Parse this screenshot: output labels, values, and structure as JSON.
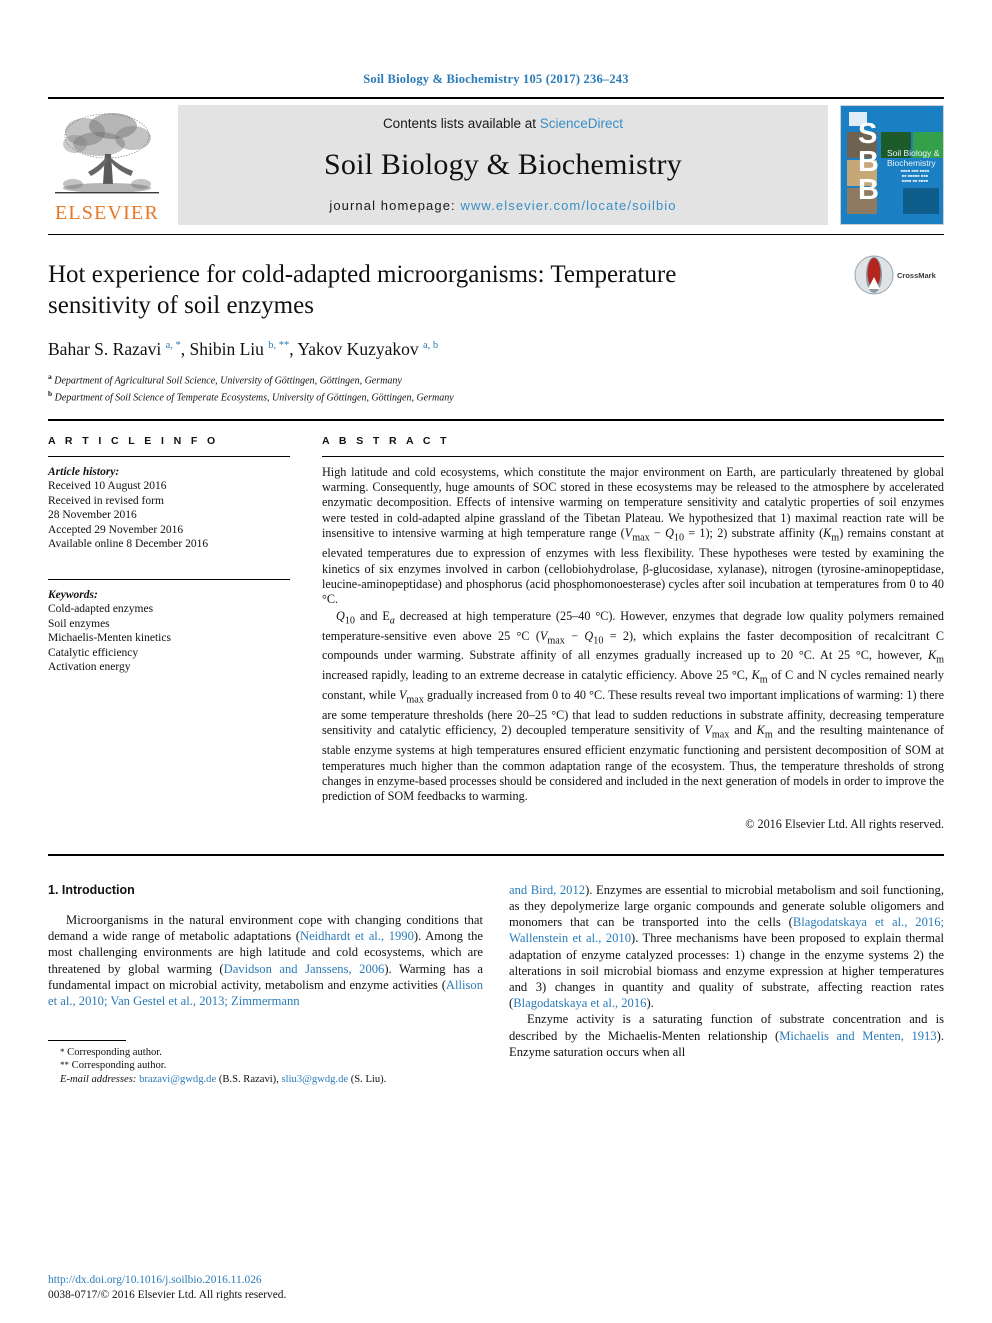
{
  "colors": {
    "link_blue": "#2b7bb9",
    "sciencedirect_blue": "#3a8ec4",
    "elsevier_orange": "#e87722",
    "cover_blue": "#1b7fc4",
    "masthead_grey": "#e3e3e3"
  },
  "running_head": "Soil Biology & Biochemistry 105 (2017) 236–243",
  "masthead": {
    "publisher": "ELSEVIER",
    "contents_prefix": "Contents lists available at ",
    "contents_link": "ScienceDirect",
    "journal_name": "Soil Biology & Biochemistry",
    "homepage_prefix": "journal homepage: ",
    "homepage_url": "www.elsevier.com/locate/soilbio",
    "cover": {
      "letters": "S\nB\nB",
      "title_line1": "Soil Biology &",
      "title_line2": "Biochemistry"
    }
  },
  "article": {
    "title": "Hot experience for cold-adapted microorganisms: Temperature sensitivity of soil enzymes",
    "crossmark_label": "CrossMark",
    "authors_html": "Bahar S. Razavi <sup>a, *</sup>, Shibin Liu <sup>b, **</sup>, Yakov Kuzyakov <sup>a, b</sup>",
    "affiliations": [
      {
        "mark": "a",
        "text": "Department of Agricultural Soil Science, University of Göttingen, Göttingen, Germany"
      },
      {
        "mark": "b",
        "text": "Department of Soil Science of Temperate Ecosystems, University of Göttingen, Göttingen, Germany"
      }
    ]
  },
  "article_info": {
    "heading": "A R T I C L E   I N F O",
    "history_label": "Article history:",
    "history": [
      "Received 10 August 2016",
      "Received in revised form",
      "28 November 2016",
      "Accepted 29 November 2016",
      "Available online 8 December 2016"
    ],
    "keywords_label": "Keywords:",
    "keywords": [
      "Cold-adapted enzymes",
      "Soil enzymes",
      "Michaelis-Menten kinetics",
      "Catalytic efficiency",
      "Activation energy"
    ]
  },
  "abstract": {
    "heading": "A B S T R A C T",
    "paragraph1_html": "High latitude and cold ecosystems, which constitute the major environment on Earth, are particularly threatened by global warming. Consequently, huge amounts of SOC stored in these ecosystems may be released to the atmosphere by accelerated enzymatic decomposition. Effects of intensive warming on temperature sensitivity and catalytic properties of soil enzymes were tested in cold-adapted alpine grassland of the Tibetan Plateau. We hypothesized that 1) maximal reaction rate will be insensitive to intensive warming at high temperature range (<i>V</i><sub>max</sub> &minus; <i>Q</i><sub>10</sub> = 1); 2) substrate affinity (<i>K</i><sub>m</sub>) remains constant at elevated temperatures due to expression of enzymes with less flexibility. These hypotheses were tested by examining the kinetics of six enzymes involved in carbon (cellobiohydrolase, &beta;-glucosidase, xylanase), nitrogen (tyrosine-aminopeptidase, leucine-aminopeptidase) and phosphorus (acid phosphomonoesterase) cycles after soil incubation at temperatures from 0 to 40 &deg;C.",
    "paragraph2_html": "<i>Q</i><sub>10</sub> and E<sub><i>a</i></sub> decreased at high temperature (25&ndash;40 &deg;C). However, enzymes that degrade low quality polymers remained temperature-sensitive even above 25 &deg;C (<i>V</i><sub>max</sub> &minus; <i>Q</i><sub>10</sub> = 2), which explains the faster decomposition of recalcitrant C compounds under warming. Substrate affinity of all enzymes gradually increased up to 20 &deg;C. At 25 &deg;C, however, <i>K</i><sub>m</sub> increased rapidly, leading to an extreme decrease in catalytic efficiency. Above 25 &deg;C, <i>K</i><sub>m</sub> of C and N cycles remained nearly constant, while <i>V</i><sub>max</sub> gradually increased from 0 to 40 &deg;C. These results reveal two important implications of warming: 1) there are some temperature thresholds (here 20&ndash;25 &deg;C) that lead to sudden reductions in substrate affinity, decreasing temperature sensitivity and catalytic efficiency, 2) decoupled temperature sensitivity of <i>V</i><sub>max</sub> and <i>K</i><sub>m</sub> and the resulting maintenance of stable enzyme systems at high temperatures ensured efficient enzymatic functioning and persistent decomposition of SOM at temperatures much higher than the common adaptation range of the ecosystem. Thus, the temperature thresholds of strong changes in enzyme-based processes should be considered and included in the next generation of models in order to improve the prediction of SOM feedbacks to warming.",
    "copyright": "© 2016 Elsevier Ltd. All rights reserved."
  },
  "introduction": {
    "section_number_title": "1.  Introduction",
    "left_paragraph_html": "Microorganisms in the natural environment cope with changing conditions that demand a wide range of metabolic adaptations (<span class=\"link\">Neidhardt et al., 1990</span>). Among the most challenging environments are high latitude and cold ecosystems, which are threatened by global warming (<span class=\"link\">Davidson and Janssens, 2006</span>). Warming has a fundamental impact on microbial activity, metabolism and enzyme activities (<span class=\"link\">Allison et al., 2010; Van Gestel et al., 2013; Zimmermann</span>",
    "right_paragraph1_html": "<span class=\"link\">and Bird, 2012</span>). Enzymes are essential to microbial metabolism and soil functioning, as they depolymerize large organic compounds and generate soluble oligomers and monomers that can be transported into the cells (<span class=\"link\">Blagodatskaya et al., 2016; Wallenstein et al., 2010</span>). Three mechanisms have been proposed to explain thermal adaptation of enzyme catalyzed processes: 1) change in the enzyme systems 2) the alterations in soil microbial biomass and enzyme expression at higher temperatures and 3) changes in quantity and quality of substrate, affecting reaction rates (<span class=\"link\">Blagodatskaya et al., 2016</span>).",
    "right_paragraph2_html": "Enzyme activity is a saturating function of substrate concentration and is described by the Michaelis-Menten relationship (<span class=\"link\">Michaelis and Menten, 1913</span>). Enzyme saturation occurs when all"
  },
  "footnotes": {
    "line1_html": "<span class=\"mark\">*</span> Corresponding author.",
    "line2_html": "<span class=\"mark\">**</span> Corresponding author.",
    "line3_html": "<i>E-mail addresses:</i> <span class=\"link\">brazavi@gwdg.de</span> (B.S. Razavi), <span class=\"link\">sliu3@gwdg.de</span> (S. Liu)."
  },
  "footer": {
    "doi_url": "http://dx.doi.org/10.1016/j.soilbio.2016.11.026",
    "issn_line": "0038-0717/© 2016 Elsevier Ltd. All rights reserved."
  }
}
